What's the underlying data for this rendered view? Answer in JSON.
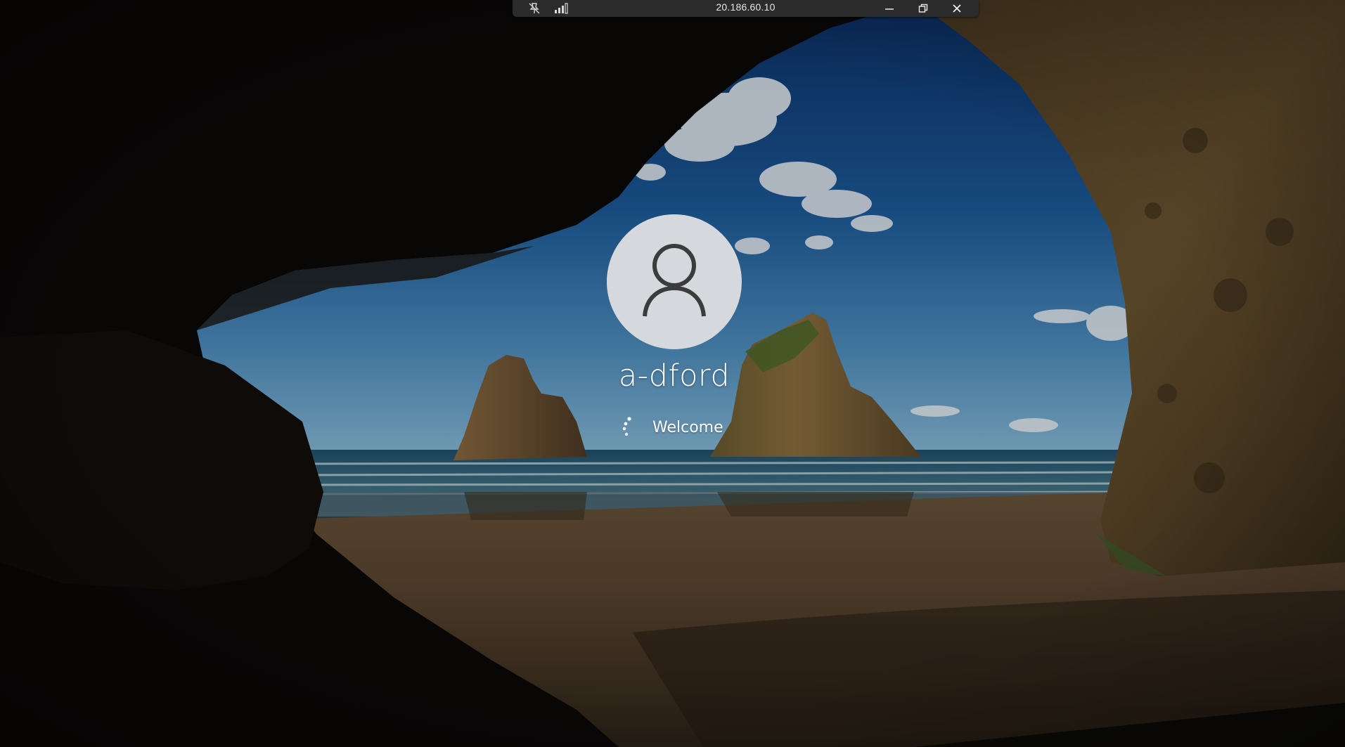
{
  "rdp_bar": {
    "title": "20.186.60.10",
    "icons": [
      "unpin-icon",
      "connection-quality-icon",
      "minimize-icon",
      "restore-icon",
      "close-icon"
    ]
  },
  "login": {
    "avatar_icon": "user-icon",
    "username": "a-dford",
    "status": "Welcome",
    "spinner_icon": "loading-spinner-icon"
  },
  "colors": {
    "rdp_bar_bg": "#2b2b2b",
    "avatar_bg": "#d5d8dc",
    "text": "#ffffff"
  }
}
